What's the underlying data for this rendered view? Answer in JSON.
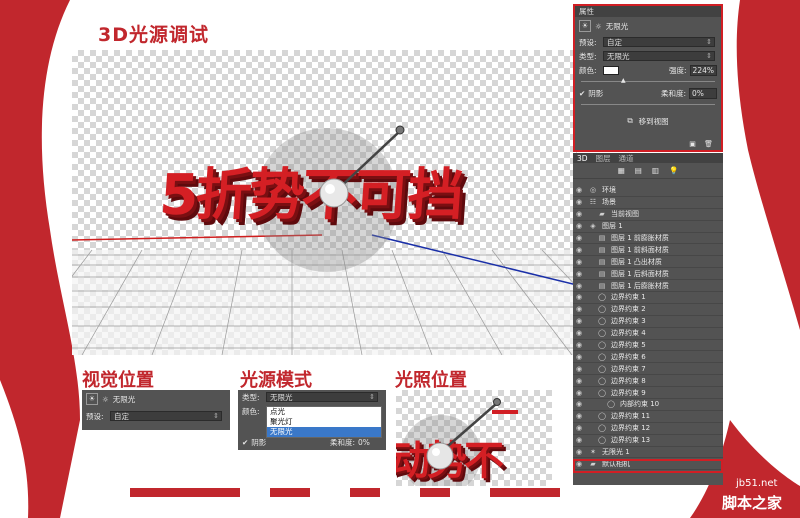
{
  "titles": {
    "main": "3D光源调试",
    "visual_position": "视觉位置",
    "light_mode": "光源模式",
    "light_position": "光照位置"
  },
  "scene_text": "5折势不可挡",
  "properties_panel": {
    "tab": "属性",
    "light_name": "无限光",
    "preset_label": "预设:",
    "preset_value": "自定",
    "type_label": "类型:",
    "type_value": "无限光",
    "color_label": "颜色:",
    "intensity_label": "强度:",
    "intensity_value": "224%",
    "shadow_label": "阴影",
    "softness_label": "柔和度:",
    "softness_value": "0%",
    "move_to_view": "移到视图"
  },
  "layers_panel": {
    "tabs": [
      "3D",
      "图层",
      "通道"
    ],
    "rows": [
      {
        "label": "环境",
        "indent": 1,
        "icon": "globe-icon"
      },
      {
        "label": "场景",
        "indent": 1,
        "icon": "scene-icon"
      },
      {
        "label": "当前视图",
        "indent": 2,
        "icon": "camera-icon"
      },
      {
        "label": "图层 1",
        "indent": 1,
        "icon": "layer-icon"
      },
      {
        "label": "图层 1 前膨胀材质",
        "indent": 2,
        "icon": "material-icon"
      },
      {
        "label": "图层 1 前斜面材质",
        "indent": 2,
        "icon": "material-icon"
      },
      {
        "label": "图层 1 凸出材质",
        "indent": 2,
        "icon": "material-icon"
      },
      {
        "label": "图层 1 后斜面材质",
        "indent": 2,
        "icon": "material-icon"
      },
      {
        "label": "图层 1 后膨胀材质",
        "indent": 2,
        "icon": "material-icon"
      },
      {
        "label": "边界约束 1",
        "indent": 2,
        "icon": "constraint-icon"
      },
      {
        "label": "边界约束 2",
        "indent": 2,
        "icon": "constraint-icon"
      },
      {
        "label": "边界约束 3",
        "indent": 2,
        "icon": "constraint-icon"
      },
      {
        "label": "边界约束 4",
        "indent": 2,
        "icon": "constraint-icon"
      },
      {
        "label": "边界约束 5",
        "indent": 2,
        "icon": "constraint-icon"
      },
      {
        "label": "边界约束 6",
        "indent": 2,
        "icon": "constraint-icon"
      },
      {
        "label": "边界约束 7",
        "indent": 2,
        "icon": "constraint-icon"
      },
      {
        "label": "边界约束 8",
        "indent": 2,
        "icon": "constraint-icon"
      },
      {
        "label": "边界约束 9",
        "indent": 2,
        "icon": "constraint-icon"
      },
      {
        "label": "内部约束 10",
        "indent": 3,
        "icon": "constraint-icon"
      },
      {
        "label": "边界约束 11",
        "indent": 2,
        "icon": "constraint-icon"
      },
      {
        "label": "边界约束 12",
        "indent": 2,
        "icon": "constraint-icon"
      },
      {
        "label": "边界约束 13",
        "indent": 2,
        "icon": "constraint-icon"
      },
      {
        "label": "无限光 1",
        "indent": 1,
        "icon": "light-icon"
      },
      {
        "label": "默认相机",
        "indent": 1,
        "icon": "camera-icon"
      }
    ]
  },
  "visual_panel": {
    "light_name": "无限光",
    "preset_label": "预设:",
    "preset_value": "自定"
  },
  "mode_panel": {
    "type_label": "类型:",
    "type_value": "无限光",
    "color_label": "颜色:",
    "options": [
      "点光",
      "聚光灯",
      "无限光"
    ],
    "shadow_label": "阴影",
    "softness_label": "柔和度:",
    "softness_value": "0%"
  },
  "crop_text": "动势不",
  "watermark": {
    "url": "jb51.net",
    "name": "脚本之家"
  },
  "colors": {
    "accent_red": "#c1272d",
    "panel_bg": "#535353",
    "highlight_blue": "#3a78c9"
  }
}
